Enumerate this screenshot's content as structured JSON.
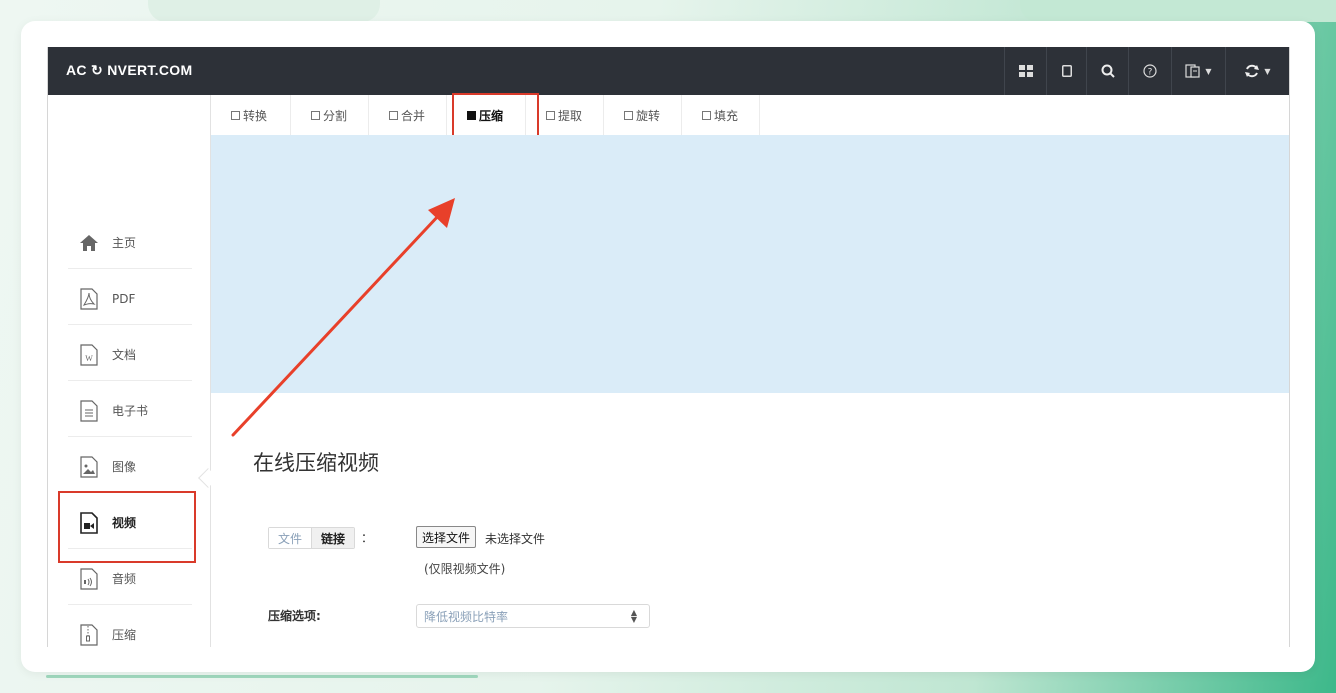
{
  "logo": {
    "prefix": "AC",
    "suffix": "NVERT.COM"
  },
  "navbar": {
    "icons": [
      "grid-icon",
      "tablet-icon",
      "search-icon",
      "help-icon",
      "language-icon",
      "refresh-icon"
    ]
  },
  "tabs": [
    {
      "label": "转换",
      "active": false
    },
    {
      "label": "分割",
      "active": false
    },
    {
      "label": "合并",
      "active": false
    },
    {
      "label": "压缩",
      "active": true
    },
    {
      "label": "提取",
      "active": false
    },
    {
      "label": "旋转",
      "active": false
    },
    {
      "label": "填充",
      "active": false
    }
  ],
  "sidebar": {
    "items": [
      {
        "label": "主页",
        "icon": "home-icon"
      },
      {
        "label": "PDF",
        "icon": "pdf-file-icon"
      },
      {
        "label": "文档",
        "icon": "word-file-icon"
      },
      {
        "label": "电子书",
        "icon": "ebook-file-icon"
      },
      {
        "label": "图像",
        "icon": "image-file-icon"
      },
      {
        "label": "视频",
        "icon": "video-file-icon",
        "active": true
      },
      {
        "label": "音频",
        "icon": "audio-file-icon"
      },
      {
        "label": "压缩",
        "icon": "archive-file-icon"
      }
    ]
  },
  "main": {
    "title": "在线压缩视频",
    "source_tabs": {
      "file": "文件",
      "link": "链接"
    },
    "colon": "：",
    "choose_button": "选择文件",
    "no_file": "未选择文件",
    "hint": "(仅限视频文件)",
    "options_label": "压缩选项:",
    "options_select_value": "降低视频比特率"
  },
  "colors": {
    "navbar": "#2d3138",
    "banner": "#daecf8",
    "highlight": "#d93a2a"
  }
}
